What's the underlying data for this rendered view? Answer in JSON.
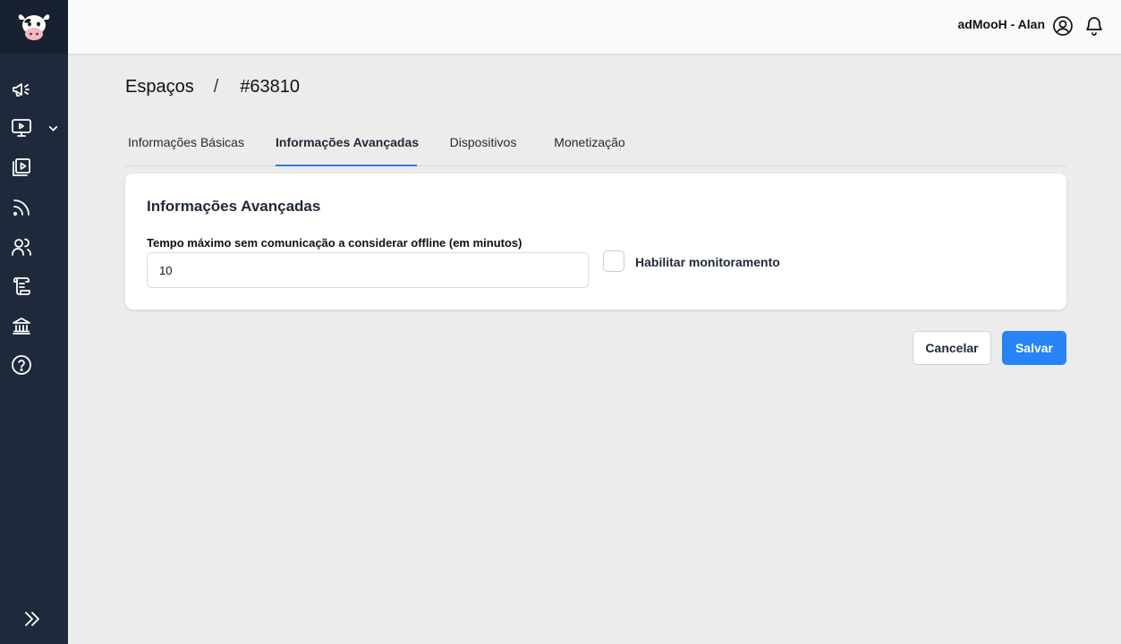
{
  "app": {
    "logo_icon": "cow-logo-icon",
    "colors": {
      "sidebar": "#1e2a3b",
      "sidebar_logo": "#17212f",
      "accent": "#2684f6",
      "tab_indicator": "#2f7ce8"
    }
  },
  "sidebar": {
    "items": [
      {
        "icon": "megaphone-icon"
      },
      {
        "icon": "monitor-play-icon",
        "has_submenu": true
      },
      {
        "icon": "playlist-icon"
      },
      {
        "icon": "rss-feed-icon"
      },
      {
        "icon": "users-icon"
      },
      {
        "icon": "scroll-icon"
      },
      {
        "icon": "bank-icon"
      },
      {
        "icon": "help-circle-icon"
      }
    ],
    "expand_icon": "double-chevron-right-icon"
  },
  "header": {
    "user_label": "adMooH - Alan",
    "user_icon": "user-circle-icon",
    "notifications_icon": "bell-icon"
  },
  "breadcrumb": {
    "root": "Espaços",
    "separator": "/",
    "current": "#63810"
  },
  "tabs": [
    {
      "label": "Informações Básicas",
      "active": false
    },
    {
      "label": "Informações Avançadas",
      "active": true
    },
    {
      "label": "Dispositivos",
      "active": false
    },
    {
      "label": "Monetização",
      "active": false
    }
  ],
  "card": {
    "title": "Informações Avançadas",
    "offline_field": {
      "label": "Tempo máximo sem comunicação a considerar offline (em minutos)",
      "value": "10"
    },
    "monitoring_checkbox": {
      "label": "Habilitar monitoramento",
      "checked": false
    }
  },
  "actions": {
    "cancel_label": "Cancelar",
    "save_label": "Salvar"
  }
}
